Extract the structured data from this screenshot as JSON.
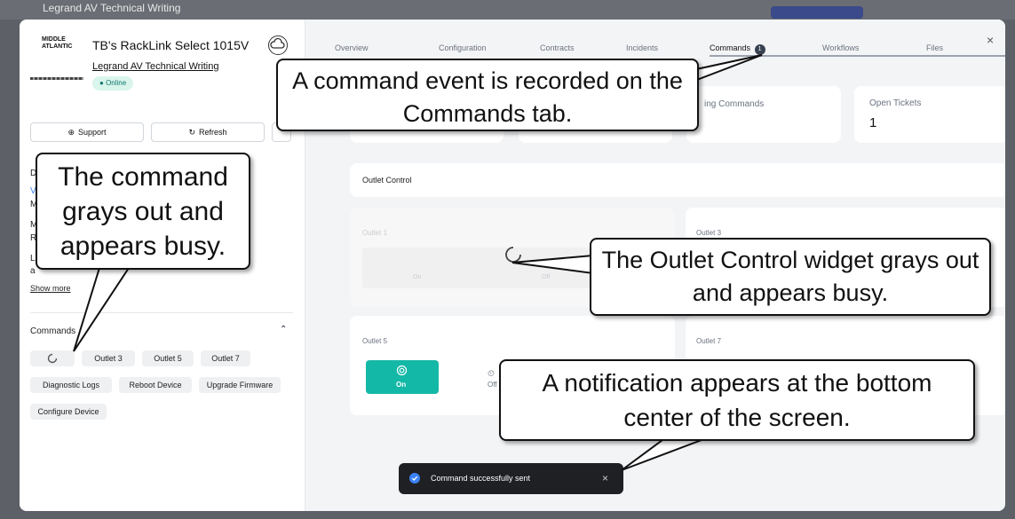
{
  "app": {
    "window_title": "Legrand AV Technical Writing"
  },
  "device": {
    "logo_line1": "MIDDLE",
    "logo_line2": "ATLANTIC",
    "title": "TB's RackLink Select 1015V",
    "org_link": "Legrand AV Technical Writing",
    "status": "Online",
    "support_label": "Support",
    "refresh_label": "Refresh",
    "show_more": "Show more",
    "details_partial": [
      "D",
      "Ve",
      "M",
      "M",
      "R",
      "La",
      "a"
    ]
  },
  "commands": {
    "heading": "Commands",
    "buttons": [
      "Outlet 3",
      "Outlet 5",
      "Outlet 7"
    ],
    "row2": [
      "Diagnostic Logs",
      "Reboot Device",
      "Upgrade Firmware"
    ],
    "row3": [
      "Configure Device"
    ]
  },
  "tabs": [
    {
      "label": "Overview"
    },
    {
      "label": "Configuration"
    },
    {
      "label": "Contracts"
    },
    {
      "label": "Incidents"
    },
    {
      "label": "Commands",
      "badge": "1"
    },
    {
      "label": "Workflows"
    },
    {
      "label": "Files"
    }
  ],
  "stats": {
    "pending_label": "ing Commands",
    "open_tickets_label": "Open Tickets",
    "open_tickets_value": "1"
  },
  "outlet_control": {
    "heading": "Outlet Control",
    "outlets": [
      {
        "name": "Outlet 1",
        "on": "On",
        "off": "Off"
      },
      {
        "name": "Outlet 3"
      },
      {
        "name": "Outlet 5",
        "on": "On",
        "off": "Off"
      },
      {
        "name": "Outlet 7"
      }
    ]
  },
  "toast": {
    "message": "Command successfully sent",
    "close": "×"
  },
  "callouts": {
    "commands_tab": "A command event is recorded on the Commands tab.",
    "command_busy": "The command grays out and appears busy.",
    "widget_busy": "The Outlet Control widget grays out and appears busy.",
    "notification": "A notification appears at the bottom center of the screen."
  },
  "colors": {
    "accent_teal": "#14b8a6",
    "online_bg": "#d9f5ec",
    "toast_bg": "#1f2023",
    "badge": "#374151"
  },
  "icons": [
    "cloud-icon",
    "support-icon",
    "refresh-icon",
    "spinner-icon",
    "power-icon",
    "close-icon",
    "check-circle-icon",
    "chevron-up-icon"
  ]
}
